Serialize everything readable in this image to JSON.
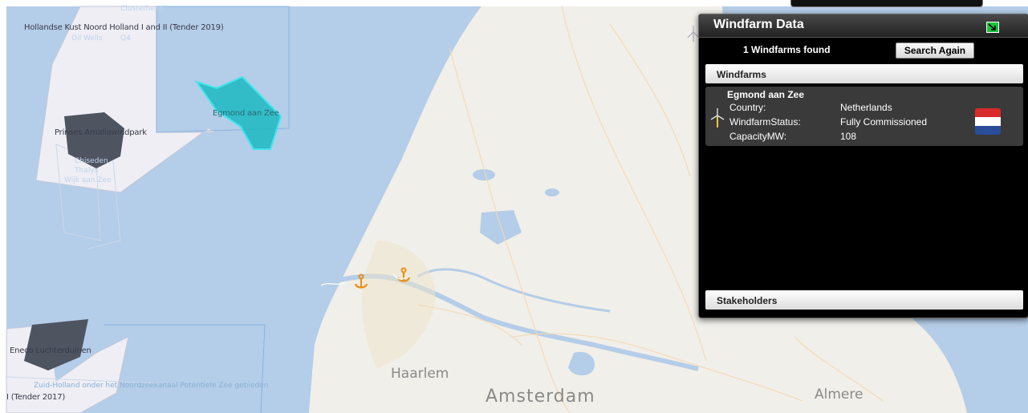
{
  "map": {
    "labels": {
      "hollandse_kust": "Hollandse Kust Noord Holland I and II (Tender 2019)",
      "egmond_aan_zee": "Egmond aan Zee",
      "prinses_amalia": "Prinses Amaliawindpark",
      "eneco": "Eneco Luchterduinen",
      "tender_2017": "I (Tender 2017)",
      "haarlem": "Haarlem",
      "amsterdam": "Amsterdam",
      "almere": "Almere",
      "oil_wells": "Oil Wells",
      "q4": "Q4",
      "clusterhead": "Clusterhead",
      "ck_inset": "Chiseden",
      "thalys": "Thalys",
      "wijk_aan_zee": "Wijk aan Zee",
      "zuid_holland": "Zuid-Holland onder het Noordzeekanaal Potentiele Zee gebieden"
    },
    "colors": {
      "sea": "#b4cde8",
      "land": "#f1efe9",
      "selected_polygon": "#1bb8c2",
      "zone": "#eeeef4",
      "dark_park": "#4e5561"
    }
  },
  "panel": {
    "title": "Windfarm Data",
    "found_text": "1 Windfarms found",
    "search_again_label": "Search Again",
    "windfarms_header": "Windfarms",
    "stakeholders_header": "Stakeholders",
    "item": {
      "name": "Egmond aan Zee",
      "country_label": "Country:",
      "country_value": "Netherlands",
      "status_label": "WindfarmStatus:",
      "status_value": "Fully Commissioned",
      "capacity_label": "CapacityMW:",
      "capacity_value": "108",
      "flag": "netherlands-flag"
    }
  }
}
